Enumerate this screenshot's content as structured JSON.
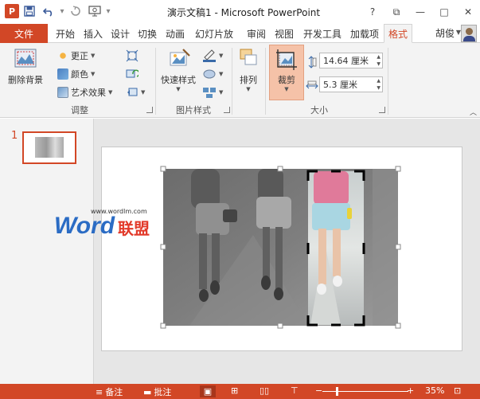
{
  "titlebar": {
    "app_icon": "P",
    "title": "演示文稿1 - Microsoft PowerPoint",
    "quick_access": [
      "save-icon",
      "undo-icon",
      "redo-icon",
      "start-from-beginning-icon"
    ],
    "window_controls": {
      "help": "?",
      "restore": "⧉",
      "minimize": "—",
      "maximize": "□",
      "close": "✕"
    }
  },
  "tabs": {
    "file": "文件",
    "items": [
      "开始",
      "插入",
      "设计",
      "切换",
      "动画",
      "幻灯片放",
      "审阅",
      "视图",
      "开发工具",
      "加载项",
      "格式"
    ],
    "active": "格式",
    "user": "胡俊"
  },
  "ribbon": {
    "adjust": {
      "remove_bg": "删除背景",
      "corrections": "更正",
      "color": "颜色",
      "artistic": "艺术效果",
      "label": "调整"
    },
    "picture_styles": {
      "quick_styles": "快速样式",
      "label": "图片样式"
    },
    "arrange": {
      "label": "排列"
    },
    "size": {
      "crop": "裁剪",
      "height": "14.64 厘米",
      "width": "5.3 厘米",
      "label": "大小"
    }
  },
  "slides": {
    "number": "1"
  },
  "watermark": {
    "url": "www.wordlm.com",
    "brand_word": "Word",
    "brand_cn": "联盟"
  },
  "statusbar": {
    "notes": "备注",
    "comments": "批注",
    "zoom_minus": "−",
    "zoom_plus": "+",
    "zoom": "35%"
  },
  "colors": {
    "accent": "#d24726",
    "ribbon_bg": "#f3f3f3",
    "workspace_bg": "#e6e6e6",
    "crop_active": "#f5c2a8"
  }
}
